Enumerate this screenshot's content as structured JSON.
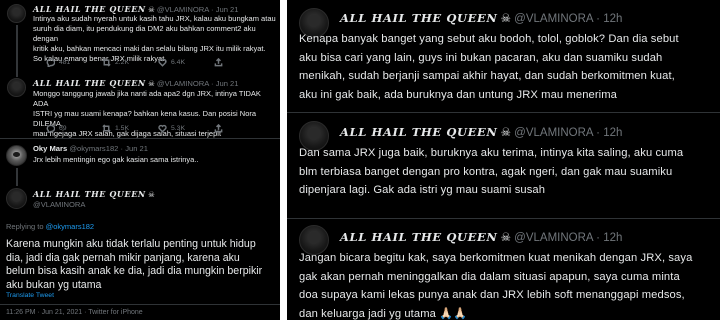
{
  "left_panel": {
    "tweets": [
      {
        "name": "ALL HAIL THE QUEEN",
        "badge": "☠",
        "handle": "@VLAMINORA",
        "dot": "·",
        "time": "Jun 21",
        "text": "Intinya aku sudah nyerah untuk kasih tahu JRX, kalau aku bungkam atau\nsuruh dia diam, itu pendukung dia DM2 aku bahkan comment2 aku dengan\nkritik aku, bahkan mencaci maki dan selalu bilang JRX itu milik rakyat.\nSo kalau emang benar JRX milik rakyat,",
        "stats": {
          "replies": "481",
          "retweets": "2.2K",
          "likes": "6.4K"
        }
      },
      {
        "name": "ALL HAIL THE QUEEN",
        "badge": "☠",
        "handle": "@VLAMINORA",
        "dot": "·",
        "time": "Jun 21",
        "text": "Monggo tanggung jawab jika nanti ada apa2 dgn JRX, intinya TIDAK ADA\nISTRI yg mau suami kenapa? bahkan kena kasus. Dan posisi Nora DILEMA,\nmau ngejaga JRX salah, gak dijaga salah, situasi terjepit",
        "stats": {
          "replies": "69",
          "retweets": "1.5K",
          "likes": "5.3K"
        }
      },
      {
        "name": "Oky Mars",
        "handle": "@okymars182",
        "dot": "·",
        "time": "Jun 21",
        "text": "Jrx lebih mentingin ego gak kasian sama istrinya.."
      }
    ],
    "main_tweet": {
      "name": "ALL HAIL THE QUEEN",
      "badge": "☠",
      "handle": "@VLAMINORA",
      "replying_prefix": "Replying to",
      "replying_to": "@okymars182",
      "text": "Karena mungkin aku tidak terlalu penting untuk hidup\ndia, jadi dia gak pernah mikir panjang, karena aku\nbelum bisa kasih anak ke dia, jadi dia mungkin berpikir\naku bukan yg utama",
      "translate": "Translate Tweet",
      "timestamp": "11:26 PM · Jun 21, 2021 · Twitter for iPhone"
    }
  },
  "right_panel": {
    "tweets": [
      {
        "name": "ALL HAIL THE QUEEN",
        "badge": "☠",
        "handle": "@VLAMINORA",
        "dot": "·",
        "time": "12h",
        "text": "Kenapa banyak banget yang sebut aku bodoh, tolol, goblok? Dan dia sebut\naku bisa cari yang lain, guys ini bukan pacaran, aku dan suamiku sudah\nmenikah, sudah berjanji sampai akhir hayat, dan sudah berkomitmen kuat,\naku ini gak baik, ada buruknya dan untung JRX mau menerima"
      },
      {
        "name": "ALL HAIL THE QUEEN",
        "badge": "☠",
        "handle": "@VLAMINORA",
        "dot": "·",
        "time": "12h",
        "text": "Dan sama JRX juga baik, buruknya aku terima, intinya kita saling, aku cuma\nblm terbiasa banget dengan pro kontra, agak ngeri, dan gak mau suamiku\ndipenjara lagi. Gak ada istri yg mau suami susah"
      },
      {
        "name": "ALL HAIL THE QUEEN",
        "badge": "☠",
        "handle": "@VLAMINORA",
        "dot": "·",
        "time": "12h",
        "text": "Jangan bicara begitu kak, saya berkomitmen kuat menikah dengan JRX, saya\ngak akan pernah meninggalkan dia dalam situasi apapun, saya cuma minta\ndoa supaya kami lekas punya anak dan JRX lebih soft menanggapi medsos,\ndan keluarga jadi yg utama 🙏🏻🙏🏻"
      }
    ]
  },
  "icons": [
    "reply-icon",
    "retweet-icon",
    "like-icon",
    "share-icon",
    "skull-icon"
  ],
  "colors": {
    "background": "#000000",
    "text": "#e7e9ea",
    "muted": "#71767b",
    "link": "#1d9bf0",
    "divider": "#2f3336"
  }
}
